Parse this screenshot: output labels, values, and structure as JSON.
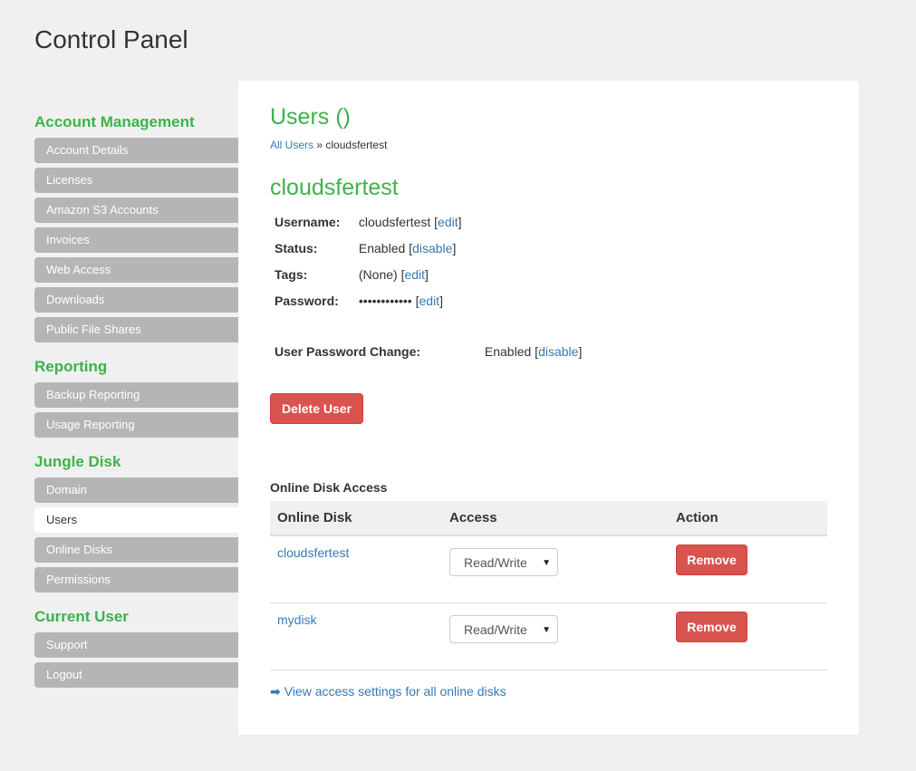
{
  "page": {
    "title": "Control Panel"
  },
  "sidebar": {
    "groups": [
      {
        "title": "Account Management",
        "items": [
          "Account Details",
          "Licenses",
          "Amazon S3 Accounts",
          "Invoices",
          "Web Access",
          "Downloads",
          "Public File Shares"
        ]
      },
      {
        "title": "Reporting",
        "items": [
          "Backup Reporting",
          "Usage Reporting"
        ]
      },
      {
        "title": "Jungle Disk",
        "items": [
          "Domain",
          "Users",
          "Online Disks",
          "Permissions"
        ],
        "active": "Users"
      },
      {
        "title": "Current User",
        "items": [
          "Support",
          "Logout"
        ]
      }
    ]
  },
  "main": {
    "heading": "Users ()",
    "breadcrumb": {
      "link": "All Users",
      "separator": "»",
      "current": "cloudsfertest"
    },
    "user_heading": "cloudsfertest",
    "fields": {
      "username": {
        "label": "Username:",
        "value": "cloudsfertest",
        "action": "edit"
      },
      "status": {
        "label": "Status:",
        "value": "Enabled",
        "action": "disable"
      },
      "tags": {
        "label": "Tags:",
        "value": "(None)",
        "action": "edit"
      },
      "password": {
        "label": "Password:",
        "value": "••••••••••••",
        "action": "edit"
      }
    },
    "password_change": {
      "label": "User Password Change:",
      "value": "Enabled",
      "action": "disable"
    },
    "delete_button": "Delete User",
    "disk_access": {
      "title": "Online Disk Access",
      "columns": [
        "Online Disk",
        "Access",
        "Action"
      ],
      "rows": [
        {
          "disk": "cloudsfertest",
          "access": "Read/Write",
          "action": "Remove"
        },
        {
          "disk": "mydisk",
          "access": "Read/Write",
          "action": "Remove"
        }
      ]
    },
    "view_all": "View access settings for all online disks"
  },
  "colors": {
    "accent_green": "#3cb34a",
    "danger": "#d9534f",
    "link": "#337ab7",
    "nav_gray": "#b5b5b5"
  },
  "icons": {
    "view_all": "arrow-right-icon",
    "select": "caret-down-icon"
  }
}
